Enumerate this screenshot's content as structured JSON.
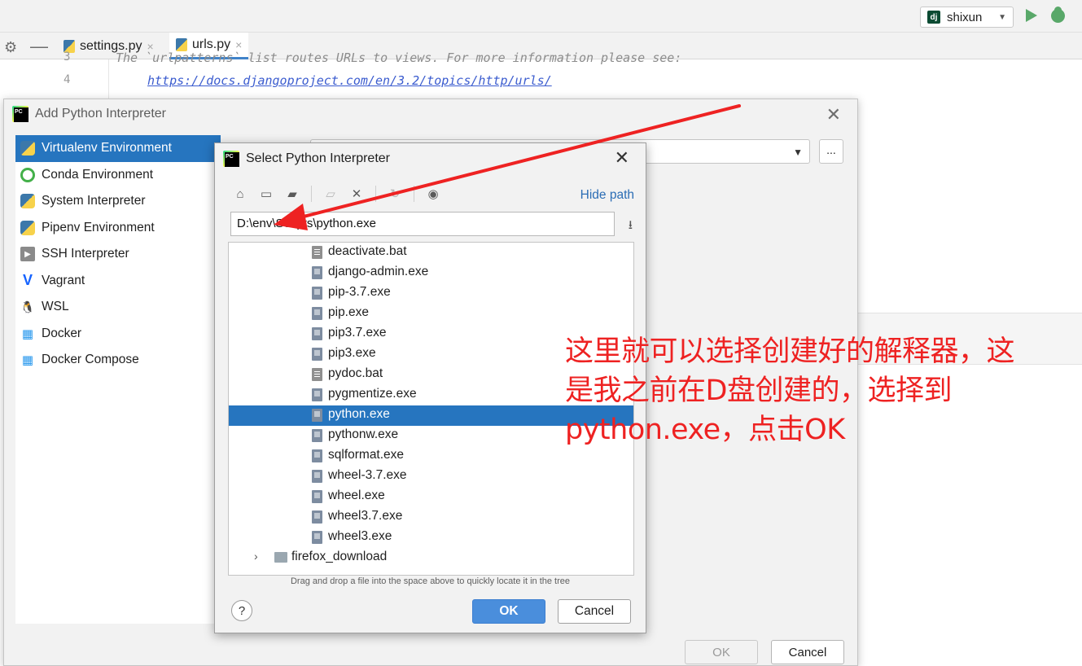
{
  "ide": {
    "run_config": {
      "name": "shixun",
      "badge": "dj"
    },
    "tabs": [
      {
        "label": "settings.py",
        "close": "×"
      },
      {
        "label": "urls.py",
        "close": "×"
      }
    ],
    "code_lines": [
      {
        "num": "3",
        "text": "The `urlpatterns` list routes URLs to views. For more information please see:"
      },
      {
        "num": "4",
        "text": "https://docs.djangoproject.com/en/3.2/topics/http/urls/"
      }
    ]
  },
  "add_dialog": {
    "title": "Add Python Interpreter",
    "environments": [
      {
        "label": "Virtualenv Environment",
        "icon": "python-icon",
        "selected": true
      },
      {
        "label": "Conda Environment",
        "icon": "conda-icon"
      },
      {
        "label": "System Interpreter",
        "icon": "python-icon"
      },
      {
        "label": "Pipenv Environment",
        "icon": "pipenv-icon"
      },
      {
        "label": "SSH Interpreter",
        "icon": "ssh-icon"
      },
      {
        "label": "Vagrant",
        "icon": "vagrant-icon"
      },
      {
        "label": "WSL",
        "icon": "linux-penguin-icon"
      },
      {
        "label": "Docker",
        "icon": "docker-icon"
      },
      {
        "label": "Docker Compose",
        "icon": "docker-icon"
      }
    ],
    "browse_label": "...",
    "ok_label": "OK",
    "cancel_label": "Cancel"
  },
  "select_dialog": {
    "title": "Select Python Interpreter",
    "hide_path_label": "Hide path",
    "path_value": "D:\\env\\Scripts\\python.exe",
    "files": [
      {
        "name": "deactivate.bat",
        "kind": "bat"
      },
      {
        "name": "django-admin.exe",
        "kind": "exe"
      },
      {
        "name": "pip-3.7.exe",
        "kind": "exe"
      },
      {
        "name": "pip.exe",
        "kind": "exe"
      },
      {
        "name": "pip3.7.exe",
        "kind": "exe"
      },
      {
        "name": "pip3.exe",
        "kind": "exe"
      },
      {
        "name": "pydoc.bat",
        "kind": "bat"
      },
      {
        "name": "pygmentize.exe",
        "kind": "exe"
      },
      {
        "name": "python.exe",
        "kind": "exe",
        "selected": true
      },
      {
        "name": "pythonw.exe",
        "kind": "exe"
      },
      {
        "name": "sqlformat.exe",
        "kind": "exe"
      },
      {
        "name": "wheel-3.7.exe",
        "kind": "exe"
      },
      {
        "name": "wheel.exe",
        "kind": "exe"
      },
      {
        "name": "wheel3.7.exe",
        "kind": "exe"
      },
      {
        "name": "wheel3.exe",
        "kind": "exe"
      }
    ],
    "folder": {
      "name": "firefox_download"
    },
    "hint": "Drag and drop a file into the space above to quickly locate it in the tree",
    "help_label": "?",
    "ok_label": "OK",
    "cancel_label": "Cancel"
  },
  "annotation": {
    "line1": "这里就可以选择创建好的解释器，这",
    "line2": "是我之前在D盘创建的，选择到",
    "line3": "python.exe，点击OK",
    "color": "#ee2222"
  },
  "colors": {
    "selection": "#2675bf",
    "ok_button": "#4a8edc",
    "link": "#2b6db5"
  }
}
